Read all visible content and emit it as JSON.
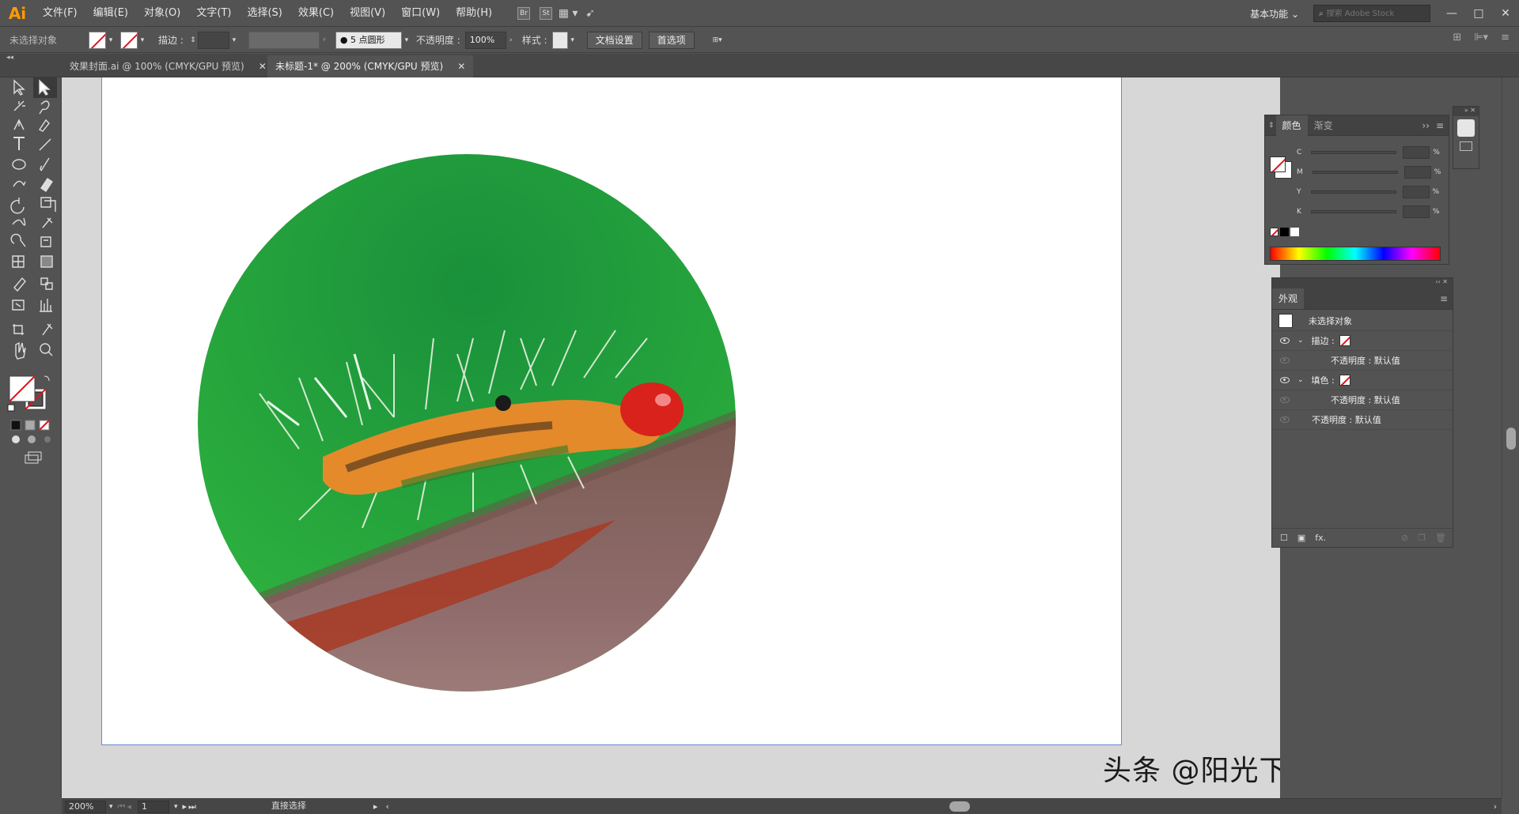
{
  "app": {
    "logo": "Ai"
  },
  "menu": [
    "文件(F)",
    "编辑(E)",
    "对象(O)",
    "文字(T)",
    "选择(S)",
    "效果(C)",
    "视图(V)",
    "窗口(W)",
    "帮助(H)"
  ],
  "menubar_icons": {
    "br": "Br",
    "st": "St"
  },
  "workspace": {
    "label": "基本功能"
  },
  "search": {
    "placeholder": "搜索 Adobe Stock"
  },
  "window_buttons": {
    "minimize": "—",
    "maximize": "□",
    "close": "✕"
  },
  "control_bar": {
    "selection_label": "未选择对象",
    "stroke_label": "描边 :",
    "brush_label": "5 点圆形",
    "opacity_label": "不透明度 :",
    "opacity_value": "100%",
    "style_label": "样式 :",
    "doc_setup_button": "文档设置",
    "prefs_button": "首选项"
  },
  "tabs": [
    {
      "label": "效果封面.ai @ 100% (CMYK/GPU 预览)",
      "close": "✕"
    },
    {
      "label": "未标题-1* @ 200% (CMYK/GPU 预览)",
      "close": "✕"
    }
  ],
  "status_bar": {
    "zoom": "200%",
    "page": "1",
    "tool": "直接选择"
  },
  "color_panel": {
    "tabs": [
      "颜色",
      "渐变"
    ],
    "channels": [
      "C",
      "M",
      "Y",
      "K"
    ],
    "percent": "%"
  },
  "appearance_panel": {
    "title": "外观",
    "header": "未选择对象",
    "stroke_label": "描边 :",
    "fill_label": "填色 :",
    "stroke_opacity": "不透明度 : 默认值",
    "fill_opacity": "不透明度 : 默认值",
    "opacity": "不透明度 : 默认值",
    "fx_label": "fx."
  },
  "watermark": "头条 @阳光下的奔跑者",
  "colors": {
    "accent": "#ff9a00",
    "ui_bg": "#535353",
    "artboard_border": "#6a8acb",
    "canvas": "#d7d7d7"
  }
}
